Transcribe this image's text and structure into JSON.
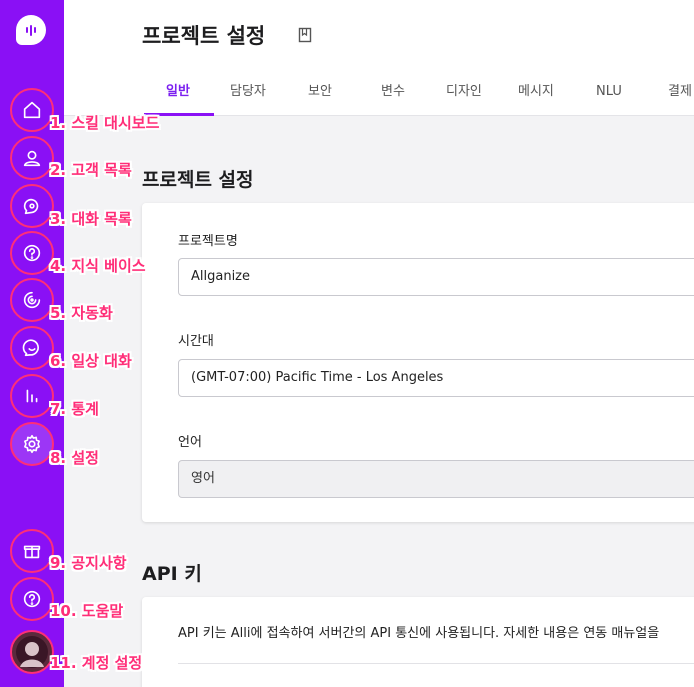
{
  "page": {
    "title": "프로젝트 설정"
  },
  "tabs": [
    {
      "label": "일반",
      "active": true
    },
    {
      "label": "담당자"
    },
    {
      "label": "보안"
    },
    {
      "label": "변수"
    },
    {
      "label": "디자인"
    },
    {
      "label": "메시지"
    },
    {
      "label": "NLU"
    },
    {
      "label": "결제"
    }
  ],
  "annotations": [
    "1. 스킬 대시보드",
    "2. 고객 목록",
    "3. 대화 목록",
    "4. 지식 베이스",
    "5. 자동화",
    "6. 일상 대화",
    "7. 통계",
    "8. 설정",
    "9. 공지사항",
    "10. 도움말",
    "11. 계정 설정"
  ],
  "settings": {
    "section_title": "프로젝트 설정",
    "project_name_label": "프로젝트명",
    "project_name_value": "Allganize",
    "timezone_label": "시간대",
    "timezone_value": "(GMT-07:00) Pacific Time - Los Angeles",
    "language_label": "언어",
    "language_value": "영어"
  },
  "api": {
    "section_title": "API 키",
    "description": "API 키는 Alli에 접속하여 서버간의 API 통신에 사용됩니다. 자세한 내용은 연동 매뉴얼을"
  },
  "colors": {
    "sidebar": "#8a10f5",
    "annotation": "#ff2e78",
    "accent": "#7b1ff0"
  }
}
